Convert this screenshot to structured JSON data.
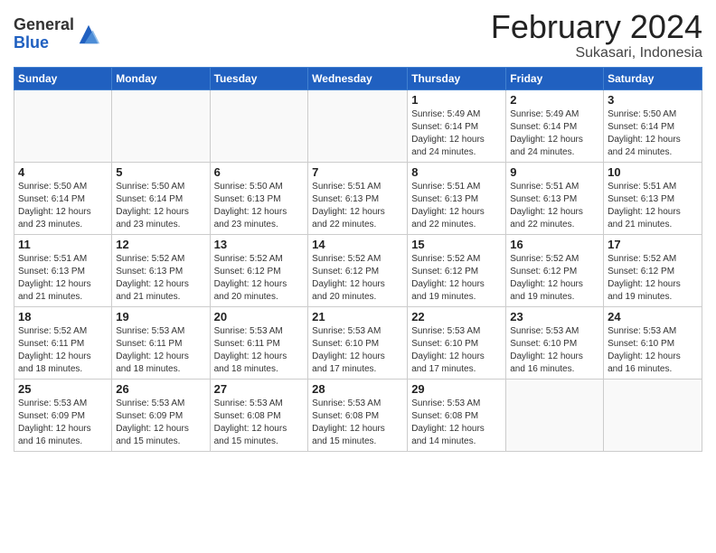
{
  "header": {
    "logo_line1": "General",
    "logo_line2": "Blue",
    "month": "February 2024",
    "location": "Sukasari, Indonesia"
  },
  "weekdays": [
    "Sunday",
    "Monday",
    "Tuesday",
    "Wednesday",
    "Thursday",
    "Friday",
    "Saturday"
  ],
  "weeks": [
    [
      {
        "day": "",
        "info": ""
      },
      {
        "day": "",
        "info": ""
      },
      {
        "day": "",
        "info": ""
      },
      {
        "day": "",
        "info": ""
      },
      {
        "day": "1",
        "info": "Sunrise: 5:49 AM\nSunset: 6:14 PM\nDaylight: 12 hours\nand 24 minutes."
      },
      {
        "day": "2",
        "info": "Sunrise: 5:49 AM\nSunset: 6:14 PM\nDaylight: 12 hours\nand 24 minutes."
      },
      {
        "day": "3",
        "info": "Sunrise: 5:50 AM\nSunset: 6:14 PM\nDaylight: 12 hours\nand 24 minutes."
      }
    ],
    [
      {
        "day": "4",
        "info": "Sunrise: 5:50 AM\nSunset: 6:14 PM\nDaylight: 12 hours\nand 23 minutes."
      },
      {
        "day": "5",
        "info": "Sunrise: 5:50 AM\nSunset: 6:14 PM\nDaylight: 12 hours\nand 23 minutes."
      },
      {
        "day": "6",
        "info": "Sunrise: 5:50 AM\nSunset: 6:13 PM\nDaylight: 12 hours\nand 23 minutes."
      },
      {
        "day": "7",
        "info": "Sunrise: 5:51 AM\nSunset: 6:13 PM\nDaylight: 12 hours\nand 22 minutes."
      },
      {
        "day": "8",
        "info": "Sunrise: 5:51 AM\nSunset: 6:13 PM\nDaylight: 12 hours\nand 22 minutes."
      },
      {
        "day": "9",
        "info": "Sunrise: 5:51 AM\nSunset: 6:13 PM\nDaylight: 12 hours\nand 22 minutes."
      },
      {
        "day": "10",
        "info": "Sunrise: 5:51 AM\nSunset: 6:13 PM\nDaylight: 12 hours\nand 21 minutes."
      }
    ],
    [
      {
        "day": "11",
        "info": "Sunrise: 5:51 AM\nSunset: 6:13 PM\nDaylight: 12 hours\nand 21 minutes."
      },
      {
        "day": "12",
        "info": "Sunrise: 5:52 AM\nSunset: 6:13 PM\nDaylight: 12 hours\nand 21 minutes."
      },
      {
        "day": "13",
        "info": "Sunrise: 5:52 AM\nSunset: 6:12 PM\nDaylight: 12 hours\nand 20 minutes."
      },
      {
        "day": "14",
        "info": "Sunrise: 5:52 AM\nSunset: 6:12 PM\nDaylight: 12 hours\nand 20 minutes."
      },
      {
        "day": "15",
        "info": "Sunrise: 5:52 AM\nSunset: 6:12 PM\nDaylight: 12 hours\nand 19 minutes."
      },
      {
        "day": "16",
        "info": "Sunrise: 5:52 AM\nSunset: 6:12 PM\nDaylight: 12 hours\nand 19 minutes."
      },
      {
        "day": "17",
        "info": "Sunrise: 5:52 AM\nSunset: 6:12 PM\nDaylight: 12 hours\nand 19 minutes."
      }
    ],
    [
      {
        "day": "18",
        "info": "Sunrise: 5:52 AM\nSunset: 6:11 PM\nDaylight: 12 hours\nand 18 minutes."
      },
      {
        "day": "19",
        "info": "Sunrise: 5:53 AM\nSunset: 6:11 PM\nDaylight: 12 hours\nand 18 minutes."
      },
      {
        "day": "20",
        "info": "Sunrise: 5:53 AM\nSunset: 6:11 PM\nDaylight: 12 hours\nand 18 minutes."
      },
      {
        "day": "21",
        "info": "Sunrise: 5:53 AM\nSunset: 6:10 PM\nDaylight: 12 hours\nand 17 minutes."
      },
      {
        "day": "22",
        "info": "Sunrise: 5:53 AM\nSunset: 6:10 PM\nDaylight: 12 hours\nand 17 minutes."
      },
      {
        "day": "23",
        "info": "Sunrise: 5:53 AM\nSunset: 6:10 PM\nDaylight: 12 hours\nand 16 minutes."
      },
      {
        "day": "24",
        "info": "Sunrise: 5:53 AM\nSunset: 6:10 PM\nDaylight: 12 hours\nand 16 minutes."
      }
    ],
    [
      {
        "day": "25",
        "info": "Sunrise: 5:53 AM\nSunset: 6:09 PM\nDaylight: 12 hours\nand 16 minutes."
      },
      {
        "day": "26",
        "info": "Sunrise: 5:53 AM\nSunset: 6:09 PM\nDaylight: 12 hours\nand 15 minutes."
      },
      {
        "day": "27",
        "info": "Sunrise: 5:53 AM\nSunset: 6:08 PM\nDaylight: 12 hours\nand 15 minutes."
      },
      {
        "day": "28",
        "info": "Sunrise: 5:53 AM\nSunset: 6:08 PM\nDaylight: 12 hours\nand 15 minutes."
      },
      {
        "day": "29",
        "info": "Sunrise: 5:53 AM\nSunset: 6:08 PM\nDaylight: 12 hours\nand 14 minutes."
      },
      {
        "day": "",
        "info": ""
      },
      {
        "day": "",
        "info": ""
      }
    ]
  ]
}
